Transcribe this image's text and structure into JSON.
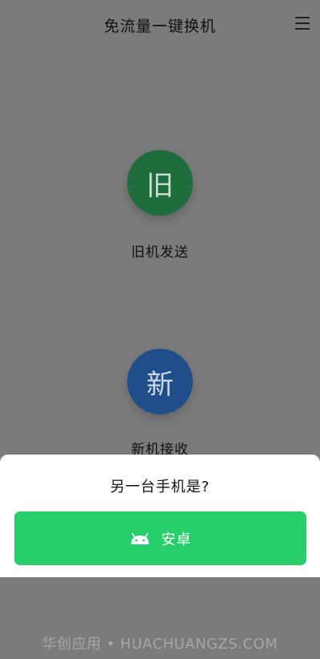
{
  "header": {
    "title": "免流量一键换机",
    "menu_icon": "hamburger-menu-icon"
  },
  "old_phone": {
    "icon_text": "旧",
    "label": "旧机发送",
    "color": "#1d6e3c"
  },
  "new_phone": {
    "icon_text": "新",
    "label": "新机接收",
    "color": "#1f4e8b"
  },
  "sheet": {
    "question": "另一台手机是?",
    "android_button_label": "安卓",
    "android_icon": "android-icon",
    "button_color": "#27cf6a"
  },
  "watermark": {
    "text": "华创应用 • HUACHUANGZS.COM"
  }
}
